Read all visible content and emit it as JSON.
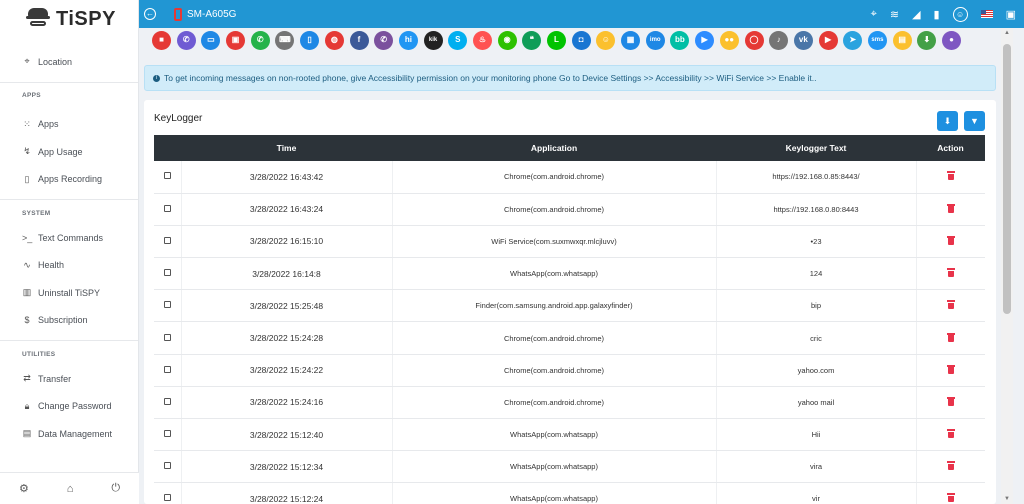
{
  "brand": {
    "name": "TiSPY"
  },
  "sidebar": {
    "top_items": [
      {
        "label": "Location",
        "icon": "location-pin-icon"
      }
    ],
    "sections": [
      {
        "title": "APPS",
        "items": [
          {
            "label": "Apps",
            "icon": "grid-icon"
          },
          {
            "label": "App Usage",
            "icon": "usage-icon"
          },
          {
            "label": "Apps Recording",
            "icon": "recording-icon"
          }
        ]
      },
      {
        "title": "SYSTEM",
        "items": [
          {
            "label": "Text Commands",
            "icon": "terminal-icon"
          },
          {
            "label": "Health",
            "icon": "pulse-icon"
          },
          {
            "label": "Uninstall TiSPY",
            "icon": "trash-icon"
          },
          {
            "label": "Subscription",
            "icon": "dollar-icon"
          }
        ]
      },
      {
        "title": "UTILITIES",
        "items": [
          {
            "label": "Transfer",
            "icon": "transfer-icon"
          },
          {
            "label": "Change Password",
            "icon": "lock-icon"
          },
          {
            "label": "Data Management",
            "icon": "database-icon"
          }
        ]
      }
    ],
    "footer_icons": [
      "gear-icon",
      "home-icon",
      "power-icon"
    ]
  },
  "topbar": {
    "device_name": "SM-A605G",
    "right_icons": [
      "gps-icon",
      "wifi-icon",
      "signal-icon",
      "battery-icon",
      "user-icon",
      "us-flag-icon",
      "gift-icon"
    ]
  },
  "app_icons": [
    {
      "name": "video-call",
      "color": "#e53935",
      "glyph": "■"
    },
    {
      "name": "phone",
      "color": "#6f5bd3",
      "glyph": "✆"
    },
    {
      "name": "chat",
      "color": "#1e88e5",
      "glyph": "▭"
    },
    {
      "name": "gallery",
      "color": "#e53935",
      "glyph": "▣"
    },
    {
      "name": "whatsapp",
      "color": "#25b34a",
      "glyph": "✆"
    },
    {
      "name": "keyboard",
      "color": "#757575",
      "glyph": "⌨"
    },
    {
      "name": "device",
      "color": "#1e88e5",
      "glyph": "▯"
    },
    {
      "name": "browser",
      "color": "#e53935",
      "glyph": "◍"
    },
    {
      "name": "facebook",
      "color": "#3b5998",
      "glyph": "f"
    },
    {
      "name": "viber",
      "color": "#7b519d",
      "glyph": "✆"
    },
    {
      "name": "hike",
      "color": "#2196f3",
      "glyph": "hi"
    },
    {
      "name": "kik",
      "color": "#222222",
      "glyph": "kik"
    },
    {
      "name": "skype",
      "color": "#00aff0",
      "glyph": "S"
    },
    {
      "name": "tinder",
      "color": "#ff5252",
      "glyph": "♨"
    },
    {
      "name": "wechat",
      "color": "#2dc100",
      "glyph": "◉"
    },
    {
      "name": "hangouts",
      "color": "#0f9d58",
      "glyph": "❝"
    },
    {
      "name": "line",
      "color": "#00c300",
      "glyph": "L"
    },
    {
      "name": "instagram",
      "color": "#1976d2",
      "glyph": "◘"
    },
    {
      "name": "snapchat",
      "color": "#fbc02d",
      "glyph": "☺"
    },
    {
      "name": "calendar",
      "color": "#1e88e5",
      "glyph": "▦"
    },
    {
      "name": "imo",
      "color": "#1e88e5",
      "glyph": "imo"
    },
    {
      "name": "bbm",
      "color": "#00bfa5",
      "glyph": "bb"
    },
    {
      "name": "zoom",
      "color": "#2d8cff",
      "glyph": "▶"
    },
    {
      "name": "flickr",
      "color": "#fbc02d",
      "glyph": "●●"
    },
    {
      "name": "hangout-red",
      "color": "#e53935",
      "glyph": "◯"
    },
    {
      "name": "music",
      "color": "#757575",
      "glyph": "♪"
    },
    {
      "name": "vk",
      "color": "#4a76a8",
      "glyph": "vk"
    },
    {
      "name": "youtube",
      "color": "#e53935",
      "glyph": "▶"
    },
    {
      "name": "telegram",
      "color": "#2aa3df",
      "glyph": "➤"
    },
    {
      "name": "sms",
      "color": "#2196f3",
      "glyph": "sms"
    },
    {
      "name": "notes",
      "color": "#fbc02d",
      "glyph": "▤"
    },
    {
      "name": "download",
      "color": "#43a047",
      "glyph": "⬇"
    },
    {
      "name": "location",
      "color": "#7e57c2",
      "glyph": "●"
    }
  ],
  "alert": {
    "text": "To get incoming messages on non-rooted phone, give Accessibility permission on your monitoring phone Go to Device Settings >> Accessibility >> WiFi Service >> Enable it.."
  },
  "keylogger": {
    "title": "KeyLogger",
    "columns": {
      "time": "Time",
      "application": "Application",
      "text": "Keylogger Text",
      "action": "Action"
    },
    "rows": [
      {
        "time": "3/28/2022 16:43:42",
        "application": "Chrome(com.android.chrome)",
        "text": "https://192.168.0.85:8443/"
      },
      {
        "time": "3/28/2022 16:43:24",
        "application": "Chrome(com.android.chrome)",
        "text": "https://192.168.0.80:8443"
      },
      {
        "time": "3/28/2022 16:15:10",
        "application": "WiFi Service(com.suxmwxqr.mlcjluvv)",
        "text": "•23"
      },
      {
        "time": "3/28/2022 16:14:8",
        "application": "WhatsApp(com.whatsapp)",
        "text": "124"
      },
      {
        "time": "3/28/2022 15:25:48",
        "application": "Finder(com.samsung.android.app.galaxyfinder)",
        "text": "bip"
      },
      {
        "time": "3/28/2022 15:24:28",
        "application": "Chrome(com.android.chrome)",
        "text": "cric"
      },
      {
        "time": "3/28/2022 15:24:22",
        "application": "Chrome(com.android.chrome)",
        "text": "yahoo.com"
      },
      {
        "time": "3/28/2022 15:24:16",
        "application": "Chrome(com.android.chrome)",
        "text": "yahoo mail"
      },
      {
        "time": "3/28/2022 15:12:40",
        "application": "WhatsApp(com.whatsapp)",
        "text": "Hii"
      },
      {
        "time": "3/28/2022 15:12:34",
        "application": "WhatsApp(com.whatsapp)",
        "text": "vira"
      },
      {
        "time": "3/28/2022 15:12:24",
        "application": "WhatsApp(com.whatsapp)",
        "text": "vir"
      }
    ]
  }
}
